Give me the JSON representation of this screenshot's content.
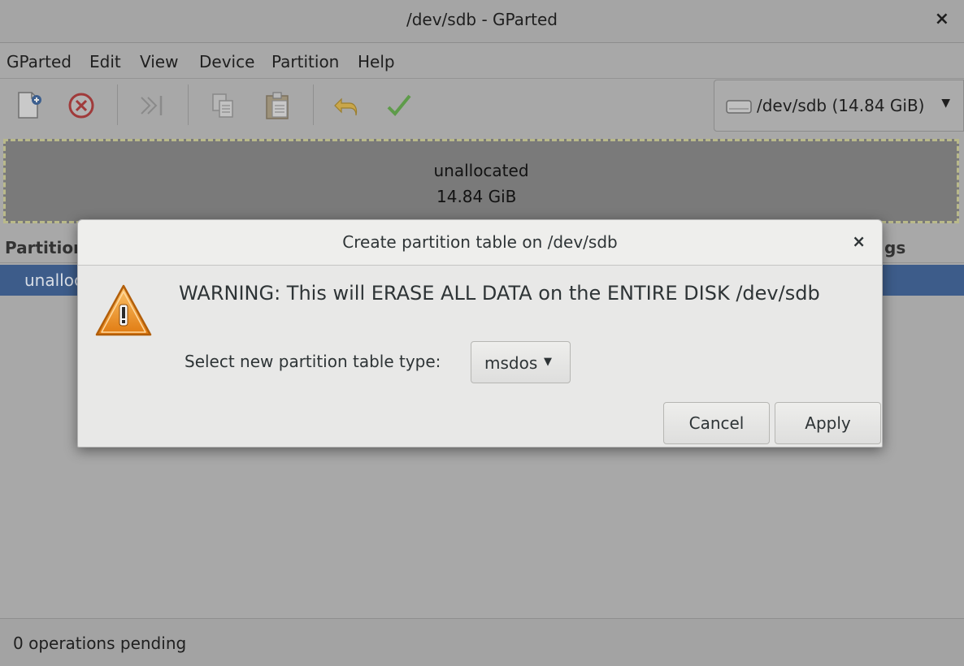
{
  "window": {
    "title": "/dev/sdb - GParted",
    "close_label": "×"
  },
  "menubar": {
    "items": [
      "GParted",
      "Edit",
      "View",
      "Device",
      "Partition",
      "Help"
    ]
  },
  "toolbar": {
    "buttons": [
      "new-partition-icon",
      "delete-icon",
      "resize-move-icon",
      "copy-icon",
      "paste-icon",
      "undo-icon",
      "apply-icon"
    ]
  },
  "device_selector": {
    "label": "/dev/sdb (14.84 GiB)",
    "icon": "disk-icon"
  },
  "disk_graphic": {
    "name": "unallocated",
    "size": "14.84 GiB"
  },
  "partition_list": {
    "header_left": "Partition",
    "header_right": "gs",
    "row": "unalloc"
  },
  "statusbar": {
    "text": "0 operations pending"
  },
  "dialog": {
    "title": "Create partition table on /dev/sdb",
    "close_label": "×",
    "warning": "WARNING:  This will ERASE ALL DATA on the ENTIRE DISK /dev/sdb",
    "select_label": "Select new partition table type:",
    "table_type": "msdos",
    "cancel_label": "Cancel",
    "apply_label": "Apply"
  },
  "colors": {
    "selection": "#3d5c8a",
    "warning_orange": "#e8891f",
    "dialog_bg": "#e8e8e7"
  }
}
